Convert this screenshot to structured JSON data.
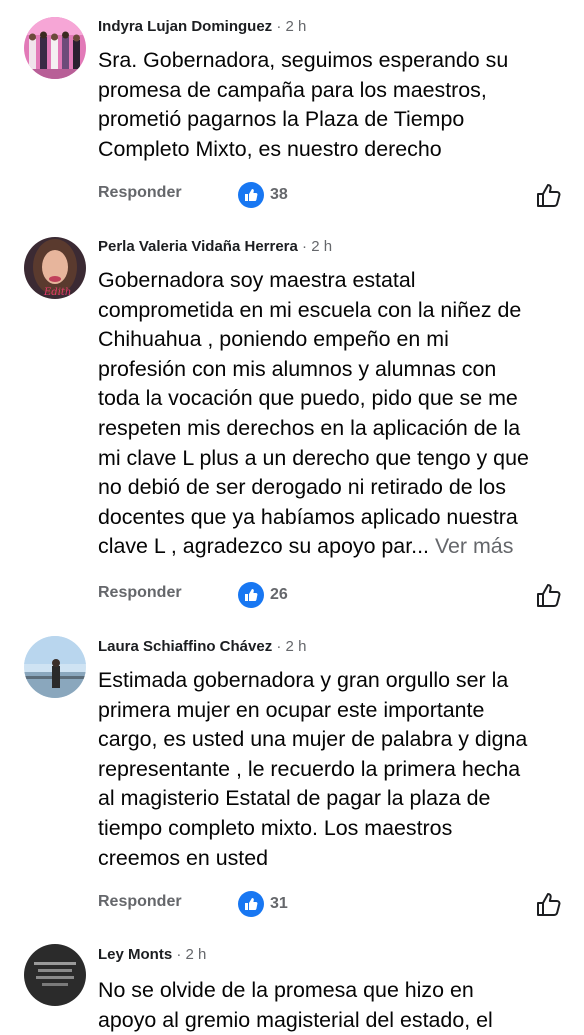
{
  "colors": {
    "accent": "#1877f2",
    "secondary_text": "#65676b"
  },
  "comments": [
    {
      "author": "Indyra Lujan Dominguez",
      "time": "· 2 h",
      "text": "Sra. Gobernadora, seguimos esperando su\npromesa de campaña para los maestros,\nprometió pagarnos la Plaza de Tiempo\nCompleto Mixto, es nuestro derecho",
      "reply_label": "Responder",
      "like_count": "38"
    },
    {
      "author": "Perla Valeria Vidaña Herrera",
      "time": "· 2 h",
      "text": "Gobernadora soy maestra estatal\ncomprometida en mi escuela con la niñez de\nChihuahua , poniendo empeño en mi\nprofesión con mis alumnos y alumnas con\ntoda la vocación que puedo, pido que se me\nrespeten mis derechos en la aplicación de la\nmi clave L plus a un derecho que tengo y que\nno debió de ser derogado ni retirado de los\ndocentes que ya habíamos aplicado nuestra\nclave L , agradezco su apoyo par...",
      "see_more": "Ver más",
      "avatar_text": "Edith",
      "reply_label": "Responder",
      "like_count": "26"
    },
    {
      "author": "Laura Schiaffino Chávez",
      "time": "· 2 h",
      "text": "Estimada gobernadora y gran orgullo ser la\nprimera mujer en ocupar este importante\ncargo, es usted una mujer de palabra y digna\nrepresentante , le recuerdo la primera hecha\nal magisterio Estatal de pagar la plaza de\ntiempo completo mixto. Los maestros\ncreemos en usted",
      "reply_label": "Responder",
      "like_count": "31"
    },
    {
      "author": "Ley Monts",
      "time": "· 2 h",
      "text": "No se olvide de la promesa que hizo en\napoyo al gremio magisterial del estado, el"
    }
  ]
}
